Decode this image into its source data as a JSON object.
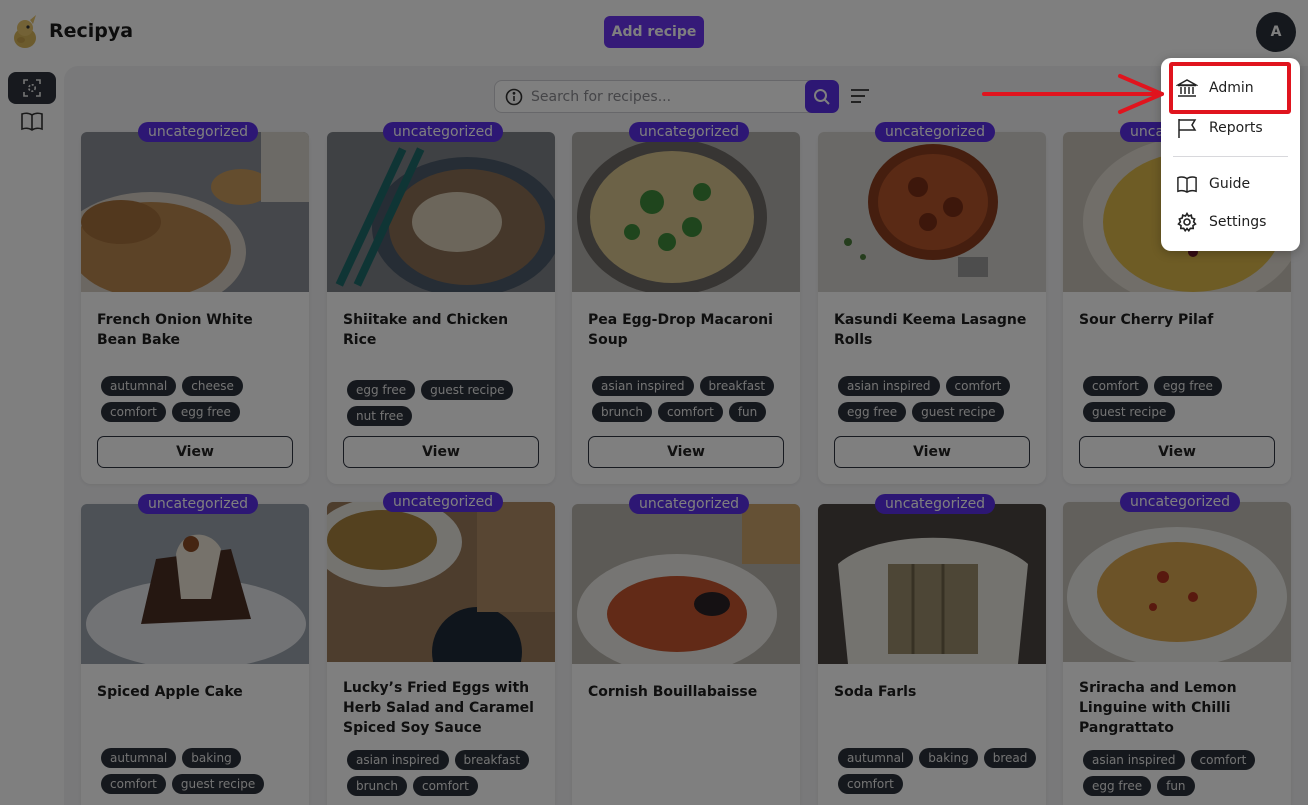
{
  "app": {
    "name": "Recipya"
  },
  "header": {
    "add_recipe_label": "Add recipe",
    "avatar_initial": "A"
  },
  "search": {
    "placeholder": "Search for recipes..."
  },
  "recipes": [
    {
      "category": "uncategorized",
      "title": "French Onion White Bean Bake",
      "tags": [
        "autumnal",
        "cheese",
        "comfort",
        "egg free"
      ],
      "view_label": "View"
    },
    {
      "category": "uncategorized",
      "title": "Shiitake and Chicken Rice",
      "tags": [
        "egg free",
        "guest recipe",
        "nut free"
      ],
      "view_label": "View"
    },
    {
      "category": "uncategorized",
      "title": "Pea Egg-Drop Macaroni Soup",
      "tags": [
        "asian inspired",
        "breakfast",
        "brunch",
        "comfort",
        "fun"
      ],
      "view_label": "View"
    },
    {
      "category": "uncategorized",
      "title": "Kasundi Keema Lasagne Rolls",
      "tags": [
        "asian inspired",
        "comfort",
        "egg free",
        "guest recipe"
      ],
      "view_label": "View"
    },
    {
      "category": "uncategorized",
      "title": "Sour Cherry Pilaf",
      "tags": [
        "comfort",
        "egg free",
        "guest recipe"
      ],
      "view_label": "View"
    },
    {
      "category": "uncategorized",
      "title": "Spiced Apple Cake",
      "tags": [
        "autumnal",
        "baking",
        "comfort",
        "guest recipe"
      ]
    },
    {
      "category": "uncategorized",
      "title": "Lucky’s Fried Eggs with Herb Salad and Caramel Spiced Soy Sauce",
      "tags": [
        "asian inspired",
        "breakfast",
        "brunch",
        "comfort"
      ]
    },
    {
      "category": "uncategorized",
      "title": "Cornish Bouillabaisse",
      "tags": []
    },
    {
      "category": "uncategorized",
      "title": "Soda Farls",
      "tags": [
        "autumnal",
        "baking",
        "bread",
        "comfort"
      ]
    },
    {
      "category": "uncategorized",
      "title": "Sriracha and Lemon Linguine with Chilli Pangrattato",
      "tags": [
        "asian inspired",
        "comfort",
        "egg free",
        "fun"
      ]
    }
  ],
  "menu": {
    "items": [
      {
        "label": "Admin",
        "icon": "bank-icon"
      },
      {
        "label": "Reports",
        "icon": "flag-icon"
      },
      {
        "label": "Guide",
        "icon": "book-open-icon"
      },
      {
        "label": "Settings",
        "icon": "gear-icon"
      }
    ]
  },
  "colors": {
    "accent": "#5a2ee8",
    "highlight": "#e0141e",
    "tag_bg": "#2b313b"
  }
}
